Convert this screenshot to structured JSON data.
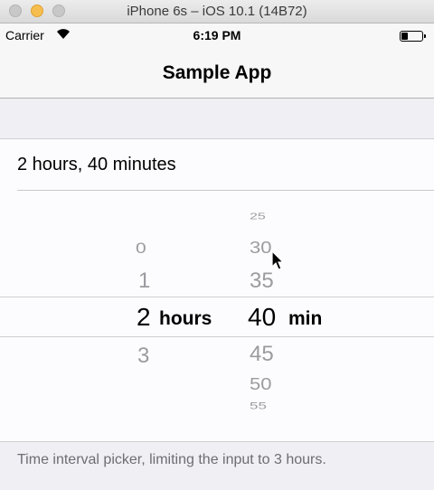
{
  "window": {
    "title": "iPhone 6s – iOS 10.1 (14B72)"
  },
  "status_bar": {
    "carrier": "Carrier",
    "time": "6:19 PM",
    "wifi_icon": "wifi-icon",
    "battery_level": 0.3
  },
  "nav": {
    "title": "Sample App"
  },
  "cell": {
    "value": "2 hours, 40 minutes"
  },
  "picker": {
    "hours": {
      "above": [
        "0",
        "1"
      ],
      "selected": "2",
      "below": [
        "3"
      ],
      "unit": "hours"
    },
    "minutes": {
      "above": [
        "25",
        "30",
        "35"
      ],
      "selected": "40",
      "below": [
        "45",
        "50",
        "55"
      ],
      "unit": "min"
    }
  },
  "footer": {
    "text": "Time interval picker, limiting the input to 3 hours."
  }
}
